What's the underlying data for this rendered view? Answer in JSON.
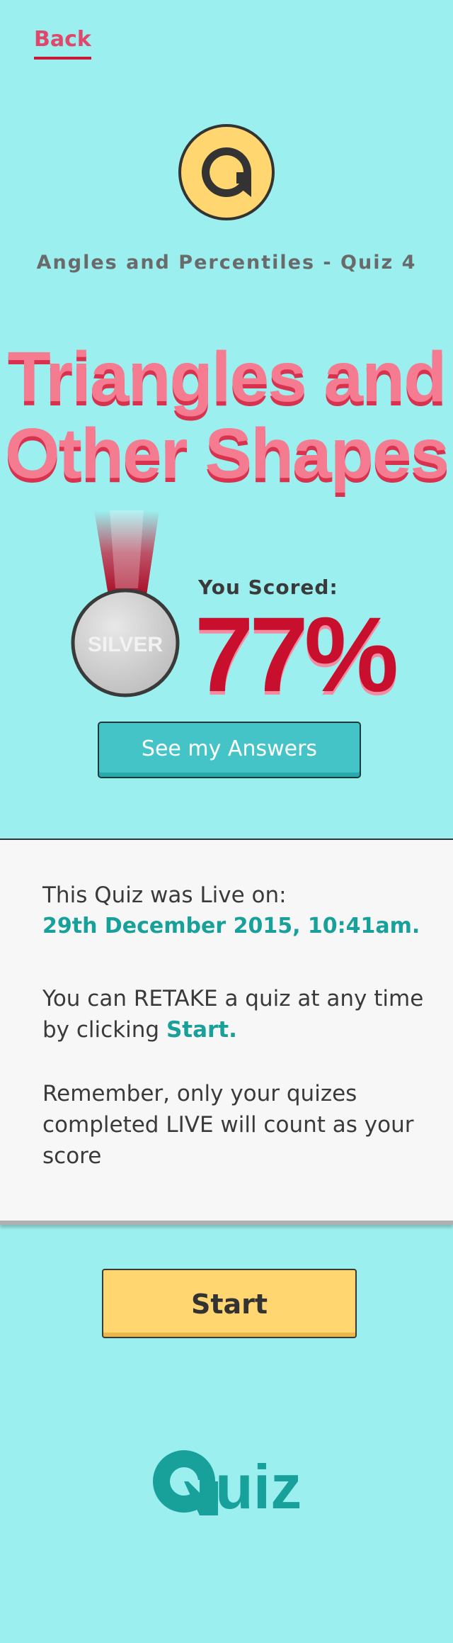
{
  "nav": {
    "back_label": "Back"
  },
  "header": {
    "logo_icon": "quiz-q-logo",
    "subtitle": "Angles and Percentiles - Quiz 4",
    "title_line1": "Triangles and",
    "title_line2": "Other Shapes"
  },
  "result": {
    "medal_label": "SILVER",
    "scored_label": "You Scored:",
    "score": "77%",
    "answers_button": "See my Answers"
  },
  "info": {
    "live_label": "This Quiz was Live on:",
    "live_date": "29th December 2015, 10:41am.",
    "retake_text": "You can RETAKE a quiz at any time by clicking",
    "retake_link": "Start.",
    "remember_text": "Remember, only your quizes completed LIVE will count as your score"
  },
  "actions": {
    "start_label": "Start"
  },
  "footer": {
    "brand_text": "uiz"
  },
  "colors": {
    "background": "#9befef",
    "accent_pink": "#f57b90",
    "accent_red": "#c8102e",
    "teal": "#18a09a",
    "button_teal": "#45c4c8",
    "button_yellow": "#ffd670"
  }
}
